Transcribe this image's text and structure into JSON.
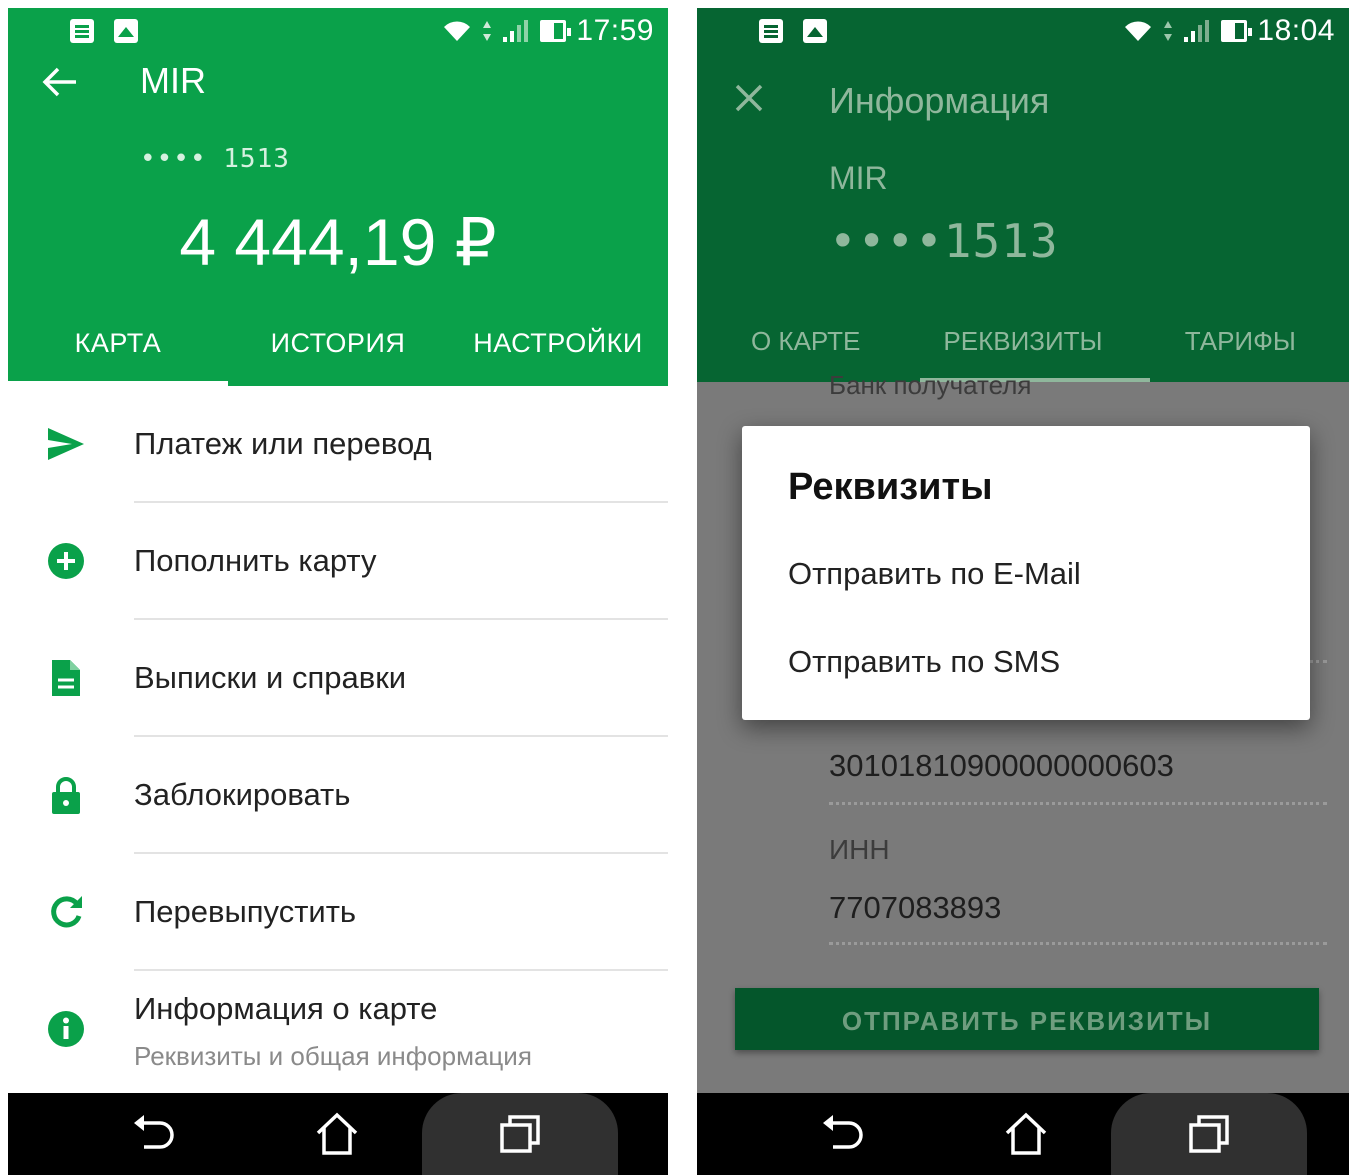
{
  "left": {
    "status": {
      "time": "17:59"
    },
    "header": {
      "title": "MIR",
      "card_mask": "•••• 1513",
      "balance": "4 444,19 ₽"
    },
    "tabs": [
      {
        "label": "КАРТА",
        "active": true
      },
      {
        "label": "ИСТОРИЯ",
        "active": false
      },
      {
        "label": "НАСТРОЙКИ",
        "active": false
      }
    ],
    "menu": [
      {
        "label": "Платеж или перевод",
        "icon": "send-icon"
      },
      {
        "label": "Пополнить карту",
        "icon": "plus-circle-icon"
      },
      {
        "label": "Выписки и справки",
        "icon": "document-icon"
      },
      {
        "label": "Заблокировать",
        "icon": "lock-icon"
      },
      {
        "label": "Перевыпустить",
        "icon": "refresh-icon"
      },
      {
        "label": "Информация о карте",
        "sublabel": "Реквизиты и общая информация",
        "icon": "info-icon"
      }
    ],
    "accent_color": "#0aa14a"
  },
  "right": {
    "status": {
      "time": "18:04"
    },
    "header": {
      "title": "Информация",
      "card": "MIR",
      "card_mask": "••••1513"
    },
    "tabs": [
      {
        "label": "О КАРТЕ",
        "active": false
      },
      {
        "label": "РЕКВИЗИТЫ",
        "active": true
      },
      {
        "label": "ТАРИФЫ",
        "active": false
      }
    ],
    "body": {
      "bank_label": "Банк получателя",
      "account_number": "30101810900000000603",
      "inn_label": "ИНН",
      "inn_value": "7707083893",
      "send_button": "ОТПРАВИТЬ РЕКВИЗИТЫ"
    },
    "dialog": {
      "title": "Реквизиты",
      "options": [
        "Отправить по E-Mail",
        "Отправить по SMS"
      ]
    },
    "header_color": "#066532"
  }
}
